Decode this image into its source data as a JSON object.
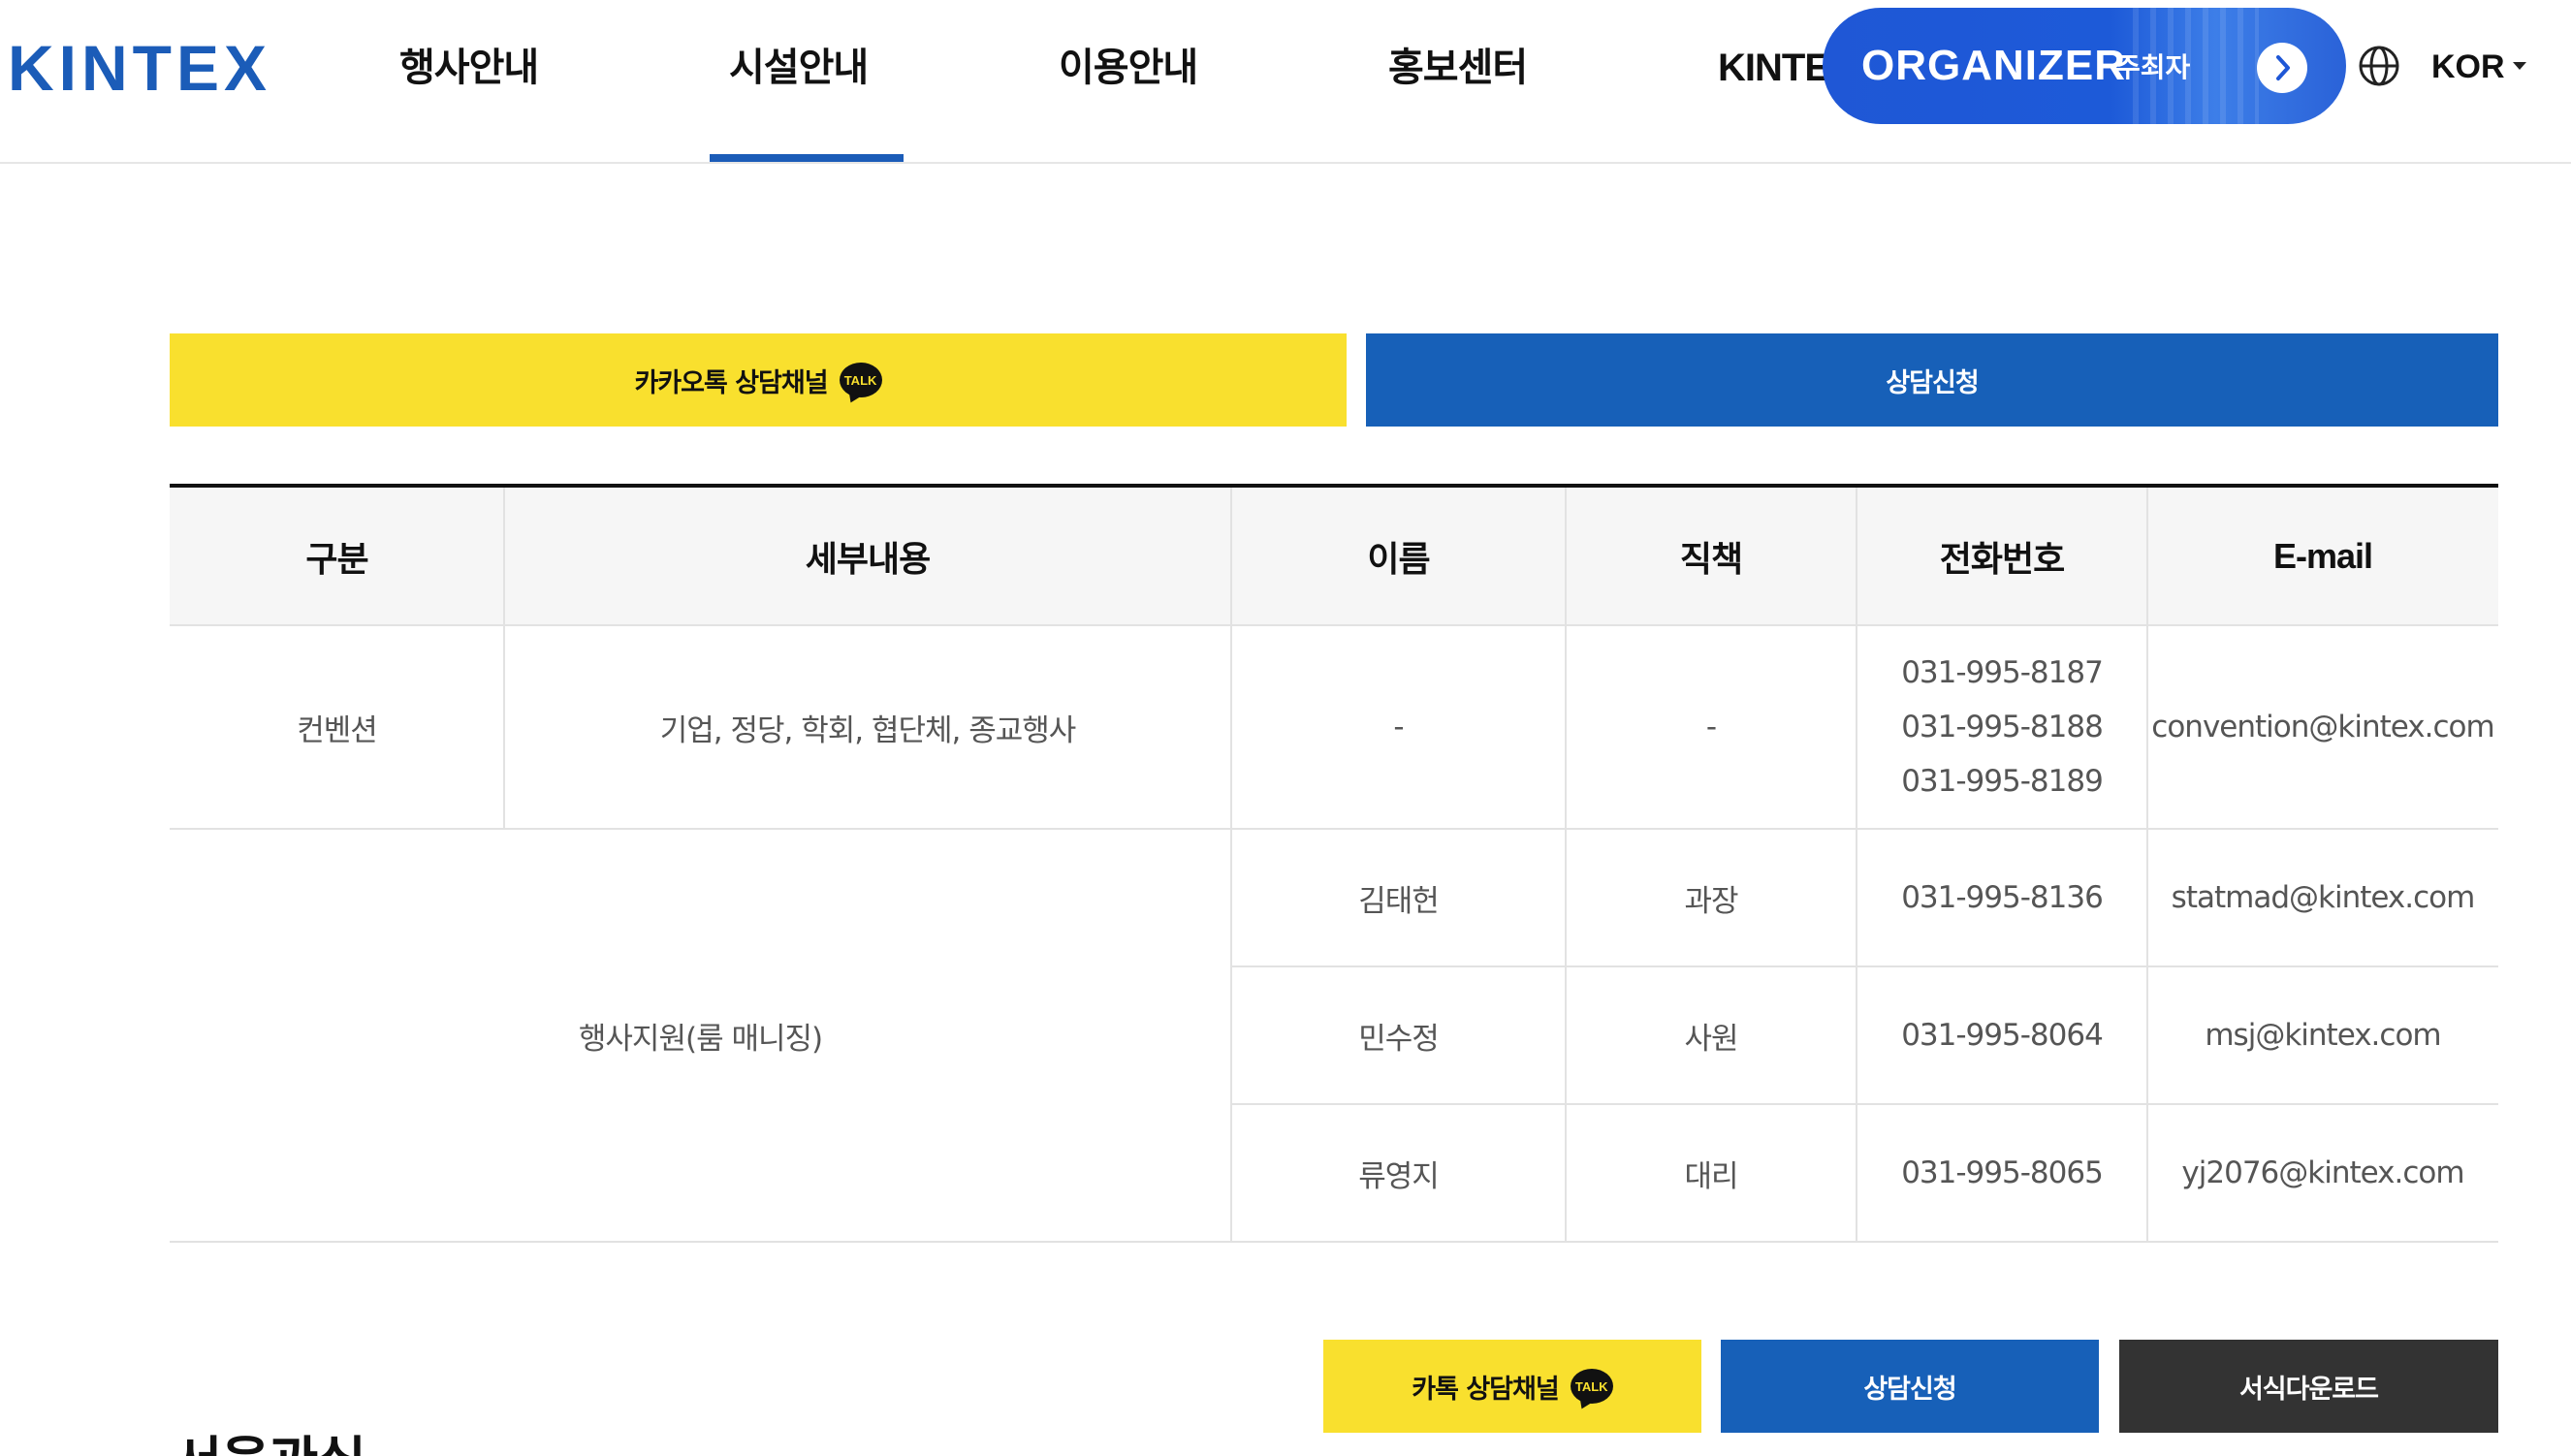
{
  "header": {
    "logo": "KINTEX",
    "nav": [
      {
        "label": "행사안내"
      },
      {
        "label": "시설안내",
        "active": true
      },
      {
        "label": "이용안내"
      },
      {
        "label": "홍보센터"
      },
      {
        "label": "KINTEX"
      }
    ],
    "organizer": {
      "title": "ORGANIZER",
      "subtitle": "주최자"
    },
    "language": "KOR"
  },
  "top_buttons": {
    "kakao": "카카오톡 상담채널",
    "talk_badge": "TALK",
    "consult": "상담신청"
  },
  "contact_table": {
    "headers": [
      "구분",
      "세부내용",
      "이름",
      "직책",
      "전화번호",
      "E-mail"
    ],
    "convention": {
      "category": "컨벤션",
      "detail": "기업, 정당, 학회, 협단체, 종교행사",
      "name": "-",
      "position": "-",
      "phones": [
        "031-995-8187",
        "031-995-8188",
        "031-995-8189"
      ],
      "email": "convention@kintex.com"
    },
    "event_support": {
      "category": "행사지원(룸 매니징)",
      "staff": [
        {
          "name": "김태헌",
          "position": "과장",
          "phone": "031-995-8136",
          "email": "statmad@kintex.com"
        },
        {
          "name": "민수정",
          "position": "사원",
          "phone": "031-995-8064",
          "email": "msj@kintex.com"
        },
        {
          "name": "류영지",
          "position": "대리",
          "phone": "031-995-8065",
          "email": "yj2076@kintex.com"
        }
      ]
    }
  },
  "bottom_buttons": {
    "kakao": "카톡 상담채널",
    "talk_badge": "TALK",
    "consult": "상담신청",
    "download": "서식다운로드"
  },
  "next_section_title": "서울관실"
}
